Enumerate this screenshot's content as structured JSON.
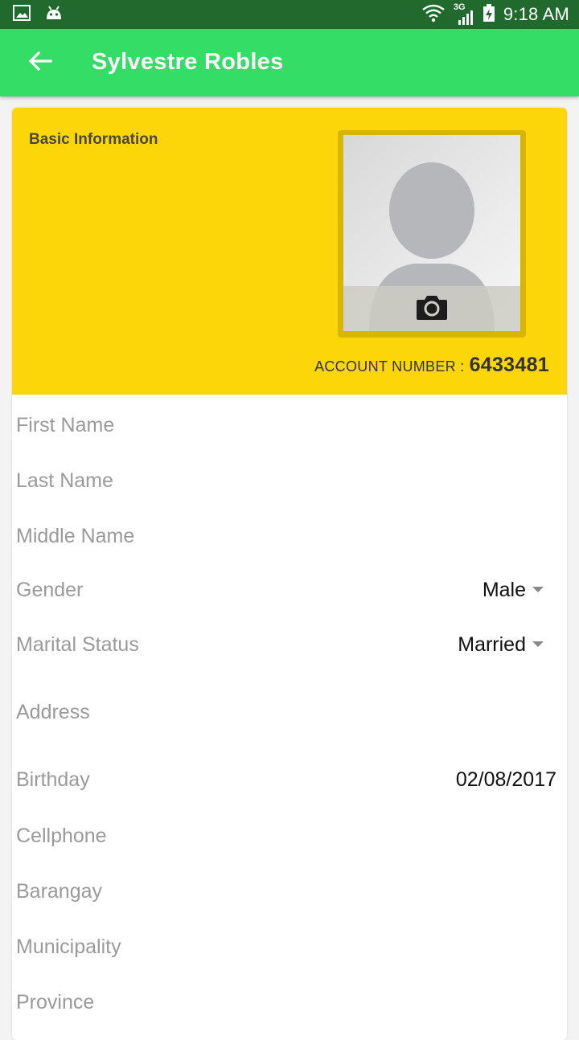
{
  "status_bar": {
    "time": "9:18 AM",
    "network": "3G",
    "icons": [
      "gallery-icon",
      "android-icon",
      "wifi-icon",
      "signal-icon",
      "battery-icon"
    ]
  },
  "app_bar": {
    "title": "Sylvestre Robles",
    "back_icon": "arrow-left-icon"
  },
  "profile": {
    "section_title": "Basic Information",
    "account_label": "ACCOUNT NUMBER :",
    "account_number": "6433481",
    "camera_icon": "camera-icon"
  },
  "fields": [
    {
      "label": "First Name",
      "value": ""
    },
    {
      "label": "Last Name",
      "value": ""
    },
    {
      "label": "Middle Name",
      "value": ""
    },
    {
      "label": "Gender",
      "value": "Male"
    },
    {
      "label": "Marital Status",
      "value": "Married"
    },
    {
      "label": "Address",
      "value": ""
    },
    {
      "label": "Birthday",
      "value": "02/08/2017"
    },
    {
      "label": "Cellphone",
      "value": ""
    },
    {
      "label": "Barangay",
      "value": ""
    },
    {
      "label": "Municipality",
      "value": ""
    },
    {
      "label": "Province",
      "value": ""
    }
  ],
  "colors": {
    "app_bar": "#34dd66",
    "status_bar": "#1f6a2c",
    "header": "#fdd60a"
  }
}
